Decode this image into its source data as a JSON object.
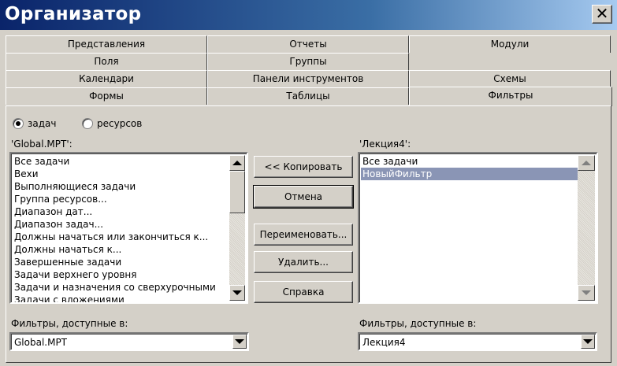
{
  "window": {
    "title": "Организатор",
    "close_label": "✕"
  },
  "tabs": {
    "row1": [
      "Представления",
      "Отчеты",
      "Модули"
    ],
    "row2": [
      "Поля",
      "Группы"
    ],
    "row3": [
      "Календари",
      "Панели инструментов",
      "Схемы"
    ],
    "row4": [
      "Формы",
      "Таблицы",
      "Фильтры"
    ]
  },
  "radios": {
    "tasks": "задач",
    "resources": "ресурсов",
    "selected": "tasks"
  },
  "left_list": {
    "label": "'Global.MPT':",
    "items": [
      "Все задачи",
      "Вехи",
      "Выполняющиеся задачи",
      "Группа ресурсов...",
      "Диапазон дат...",
      "Диапазон задач...",
      "Должны начаться или закончиться к...",
      "Должны начаться к...",
      "Завершенные задачи",
      "Задачи верхнего уровня",
      "Задачи и назначения со сверхурочными",
      "Задачи с вложениями"
    ]
  },
  "right_list": {
    "label": "'Лекция4':",
    "items": [
      "Все задачи",
      "НовыйФильтр"
    ],
    "selected_index": 1
  },
  "buttons": {
    "copy": "<< Копировать",
    "cancel": "Отмена",
    "rename": "Переименовать...",
    "delete": "Удалить...",
    "help": "Справка"
  },
  "bottom": {
    "left_label": "Фильтры, доступные в:",
    "left_value": "Global.MPT",
    "right_label": "Фильтры, доступные в:",
    "right_value": "Лекция4"
  }
}
